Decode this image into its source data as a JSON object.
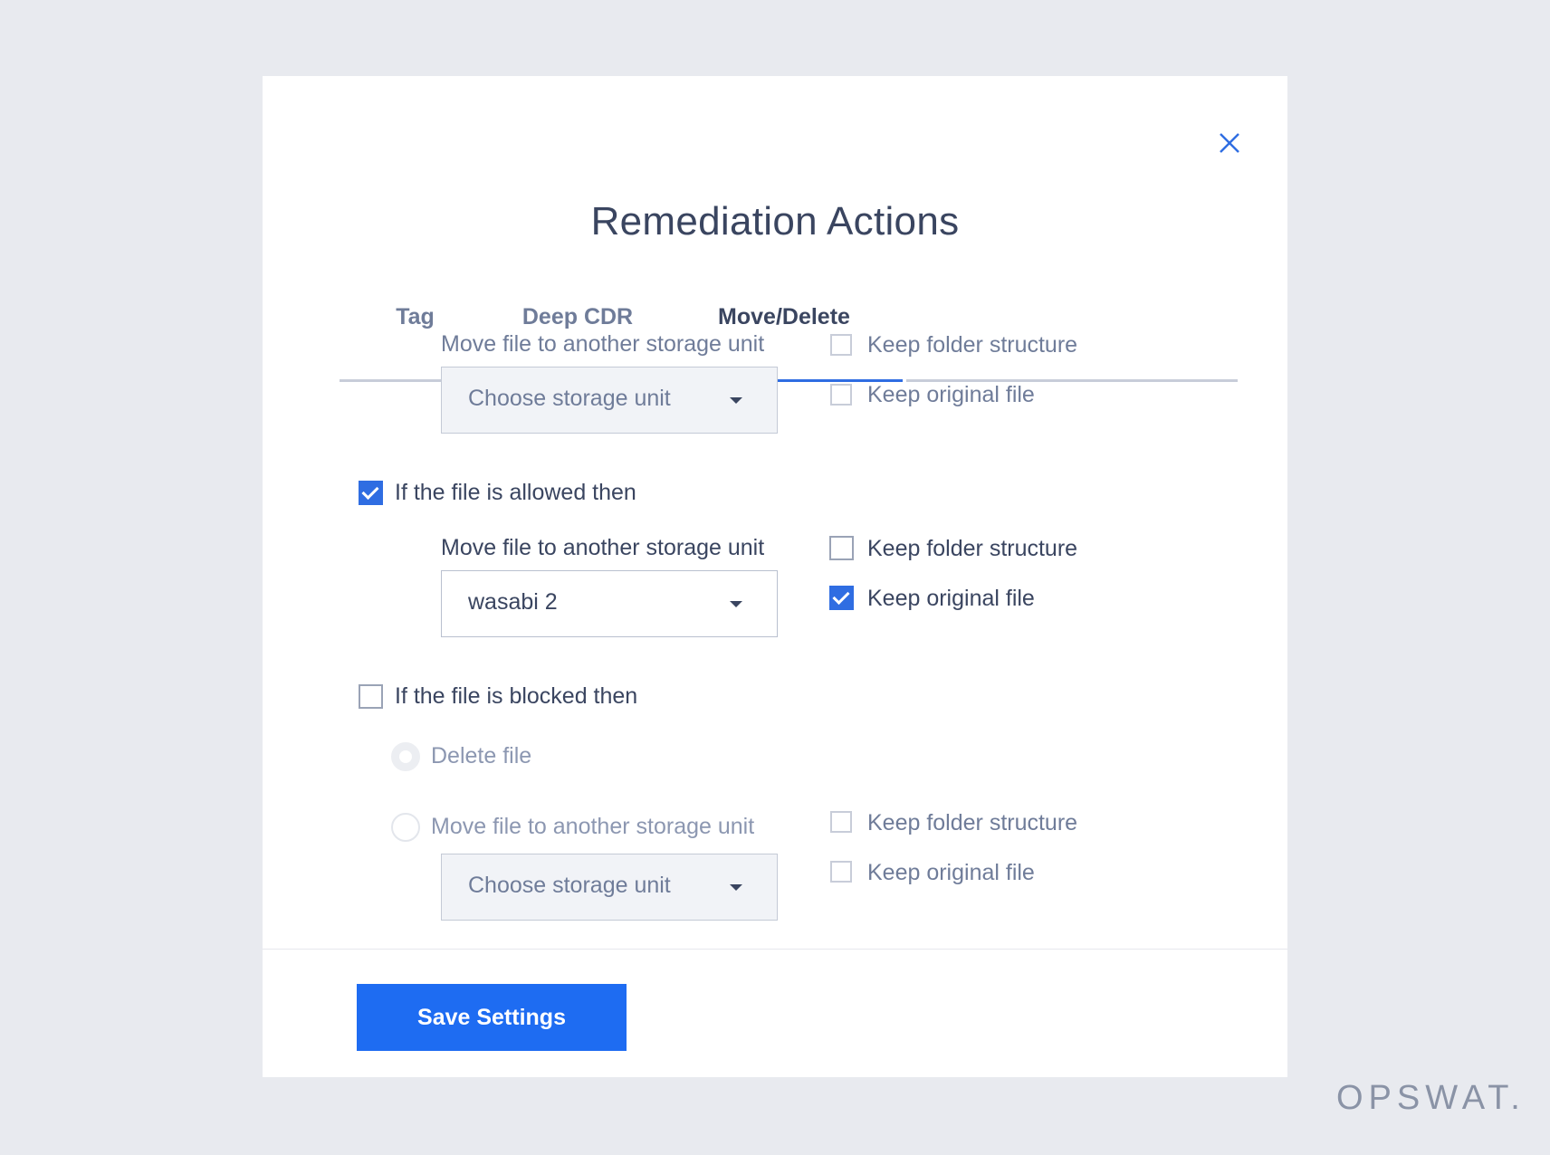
{
  "dialog": {
    "title": "Remediation Actions",
    "close_icon": "close-icon"
  },
  "tabs": [
    {
      "label": "Tag",
      "active": false
    },
    {
      "label": "Deep CDR",
      "active": false
    },
    {
      "label": "Move/Delete",
      "active": true
    }
  ],
  "section_top": {
    "move_label": "Move file to another storage unit",
    "dropdown_value": "Choose storage unit",
    "keep_folder_label": "Keep folder structure",
    "keep_folder_checked": false,
    "keep_original_label": "Keep original file",
    "keep_original_checked": false
  },
  "section_allowed": {
    "condition_label": "If the file is allowed then",
    "condition_checked": true,
    "move_label": "Move file to another storage unit",
    "dropdown_value": "wasabi 2",
    "keep_folder_label": "Keep folder structure",
    "keep_folder_checked": false,
    "keep_original_label": "Keep original file",
    "keep_original_checked": true
  },
  "section_blocked": {
    "condition_label": "If the file is blocked then",
    "condition_checked": false,
    "delete_label": "Delete file",
    "move_label": "Move file to another storage unit",
    "dropdown_value": "Choose storage unit",
    "keep_folder_label": "Keep folder structure",
    "keep_folder_checked": false,
    "keep_original_label": "Keep original file",
    "keep_original_checked": false
  },
  "footer": {
    "save_label": "Save Settings"
  },
  "brand": {
    "logo_text": "OPSWAT."
  },
  "colors": {
    "accent": "#2f6de2",
    "button": "#1e6cf2",
    "background": "#e8eaef",
    "text_dark": "#3a4560",
    "text_muted": "#6f7c99"
  }
}
